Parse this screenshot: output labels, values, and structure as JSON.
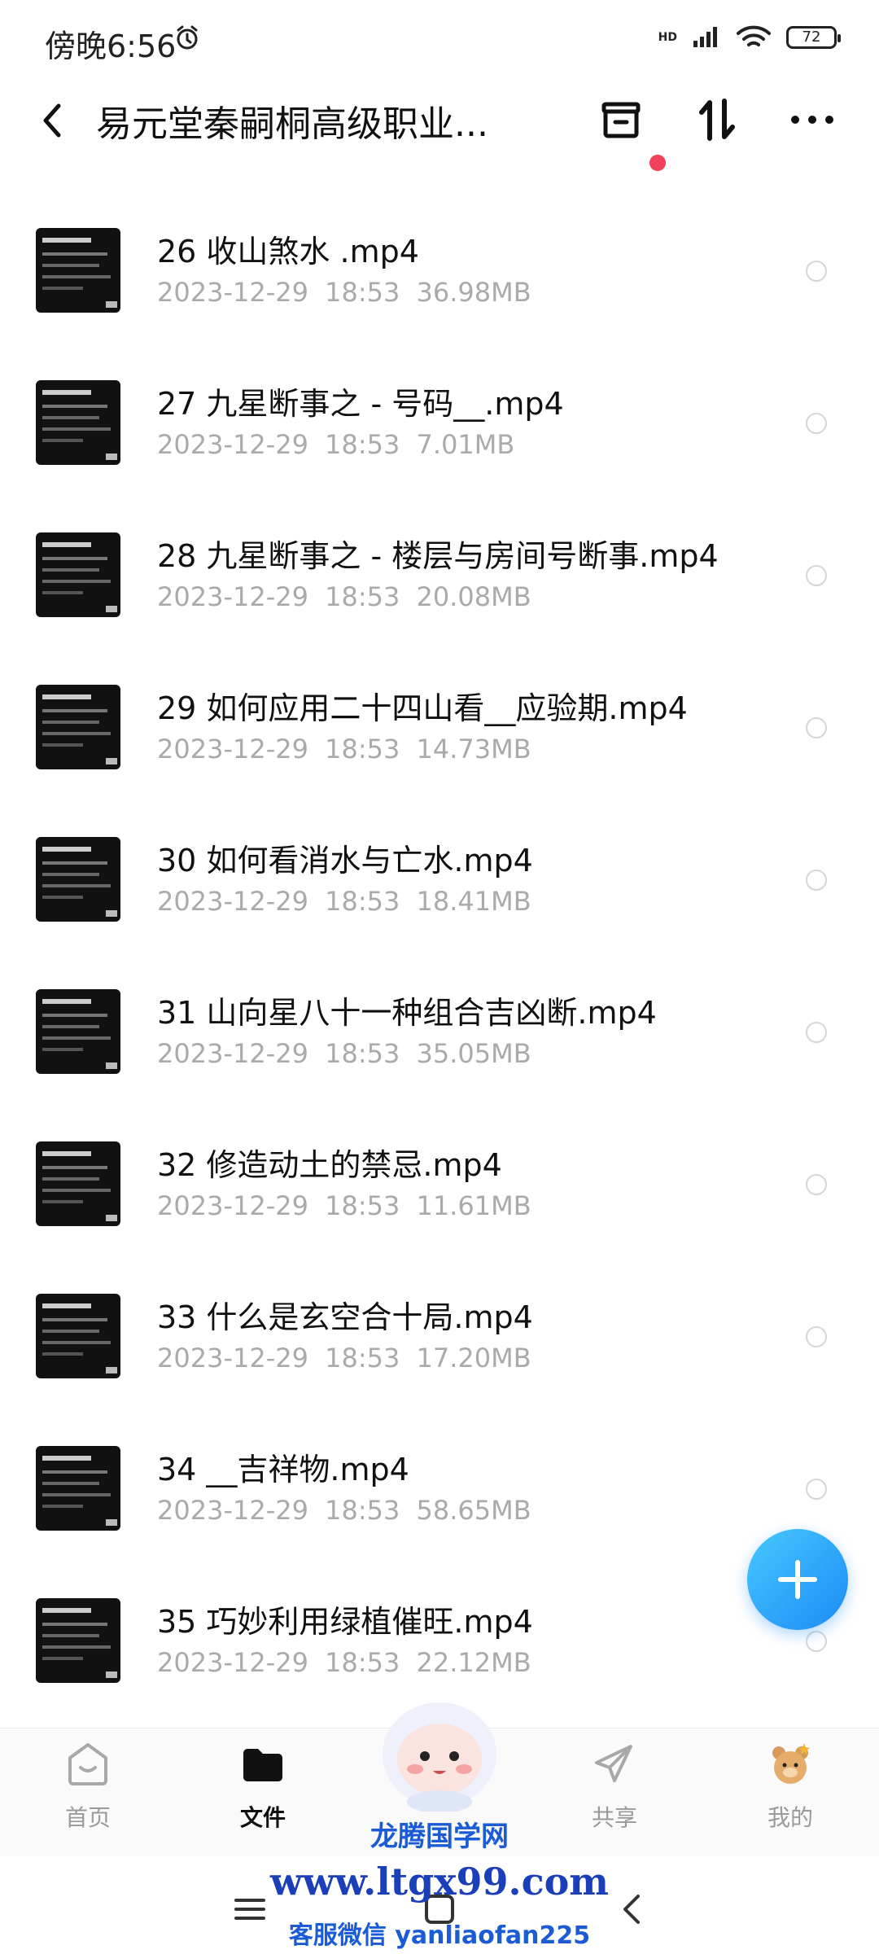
{
  "status_bar": {
    "time": "傍晚6:56",
    "battery": "72",
    "network": "HD"
  },
  "header": {
    "title": "易元堂秦嗣桐高级职业..."
  },
  "files": [
    {
      "name": "26 收山煞水 .mp4",
      "date": "2023-12-29",
      "time": "18:53",
      "size": "36.98MB"
    },
    {
      "name": "27 九星断事之 - 号码__.mp4",
      "date": "2023-12-29",
      "time": "18:53",
      "size": "7.01MB"
    },
    {
      "name": "28 九星断事之 - 楼层与房间号断事.mp4",
      "date": "2023-12-29",
      "time": "18:53",
      "size": "20.08MB"
    },
    {
      "name": "29 如何应用二十四山看__应验期.mp4",
      "date": "2023-12-29",
      "time": "18:53",
      "size": "14.73MB"
    },
    {
      "name": "30 如何看消水与亡水.mp4",
      "date": "2023-12-29",
      "time": "18:53",
      "size": "18.41MB"
    },
    {
      "name": "31 山向星八十一种组合吉凶断.mp4",
      "date": "2023-12-29",
      "time": "18:53",
      "size": "35.05MB"
    },
    {
      "name": "32 修造动土的禁忌.mp4",
      "date": "2023-12-29",
      "time": "18:53",
      "size": "11.61MB"
    },
    {
      "name": "33 什么是玄空合十局.mp4",
      "date": "2023-12-29",
      "time": "18:53",
      "size": "17.20MB"
    },
    {
      "name": "34 __吉祥物.mp4",
      "date": "2023-12-29",
      "time": "18:53",
      "size": "58.65MB"
    },
    {
      "name": "35 巧妙利用绿植催旺.mp4",
      "date": "2023-12-29",
      "time": "18:53",
      "size": "22.12MB"
    }
  ],
  "bottom_nav": {
    "items": [
      {
        "label": "首页",
        "icon": "home-icon"
      },
      {
        "label": "文件",
        "icon": "folder-icon",
        "active": true
      },
      {
        "label": "共享",
        "icon": "send-icon"
      },
      {
        "label": "我的",
        "icon": "profile-bear-icon"
      }
    ]
  },
  "watermark": {
    "line1": "龙腾国学网",
    "line2": "www.ltgx99.com",
    "line3": "客服微信 yanliaofan225"
  },
  "colors": {
    "accent": "#1d8bf5",
    "notification_dot": "#f2425a",
    "meta_text": "#aaaaaa"
  }
}
